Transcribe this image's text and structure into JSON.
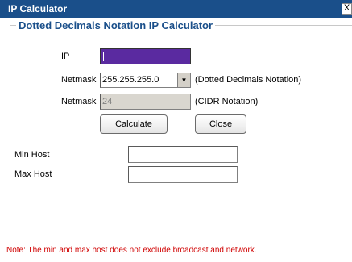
{
  "window": {
    "title": "IP Calculator",
    "close_glyph": "X"
  },
  "group": {
    "title": "Dotted Decimals Notation IP Calculator"
  },
  "form": {
    "ip_label": "IP",
    "ip_value": "",
    "netmask_label": "Netmask",
    "netmask_value": "255.255.255.0",
    "netmask_hint": "(Dotted Decimals Notation)",
    "cidr_label": "Netmask",
    "cidr_value": "24",
    "cidr_hint": "(CIDR Notation)",
    "calculate_label": "Calculate",
    "close_label": "Close"
  },
  "results": {
    "min_host_label": "Min Host",
    "min_host_value": "",
    "max_host_label": "Max Host",
    "max_host_value": ""
  },
  "note": "Note: The min and max host does not exclude broadcast and network."
}
